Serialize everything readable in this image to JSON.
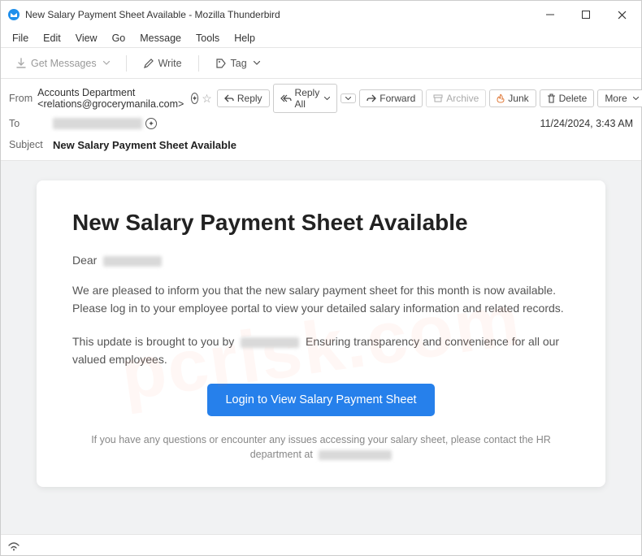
{
  "window": {
    "title": "New Salary Payment Sheet Available - Mozilla Thunderbird"
  },
  "menu": {
    "file": "File",
    "edit": "Edit",
    "view": "View",
    "go": "Go",
    "message": "Message",
    "tools": "Tools",
    "help": "Help"
  },
  "toolbar": {
    "get_messages": "Get Messages",
    "write": "Write",
    "tag": "Tag"
  },
  "headers": {
    "from_label": "From",
    "from_value": "Accounts Department <relations@grocerymanila.com>",
    "to_label": "To",
    "subject_label": "Subject",
    "subject_value": "New Salary Payment Sheet Available",
    "timestamp": "11/24/2024, 3:43 AM"
  },
  "actions": {
    "reply": "Reply",
    "reply_all": "Reply All",
    "forward": "Forward",
    "archive": "Archive",
    "junk": "Junk",
    "delete": "Delete",
    "more": "More"
  },
  "email_body": {
    "heading": "New Salary Payment Sheet Available",
    "greeting_prefix": "Dear",
    "para1": "We are pleased to inform you that the new salary payment sheet for this month is now available. Please log in to your employee portal to view your detailed salary information and related records.",
    "para2_prefix": "This update is brought to you by",
    "para2_suffix": "Ensuring transparency and convenience for all our valued employees.",
    "button": "Login to View Salary Payment Sheet",
    "footer": "If you have any questions or encounter any issues accessing your salary sheet, please contact the HR department at"
  },
  "colors": {
    "accent_button": "#2680eb"
  }
}
